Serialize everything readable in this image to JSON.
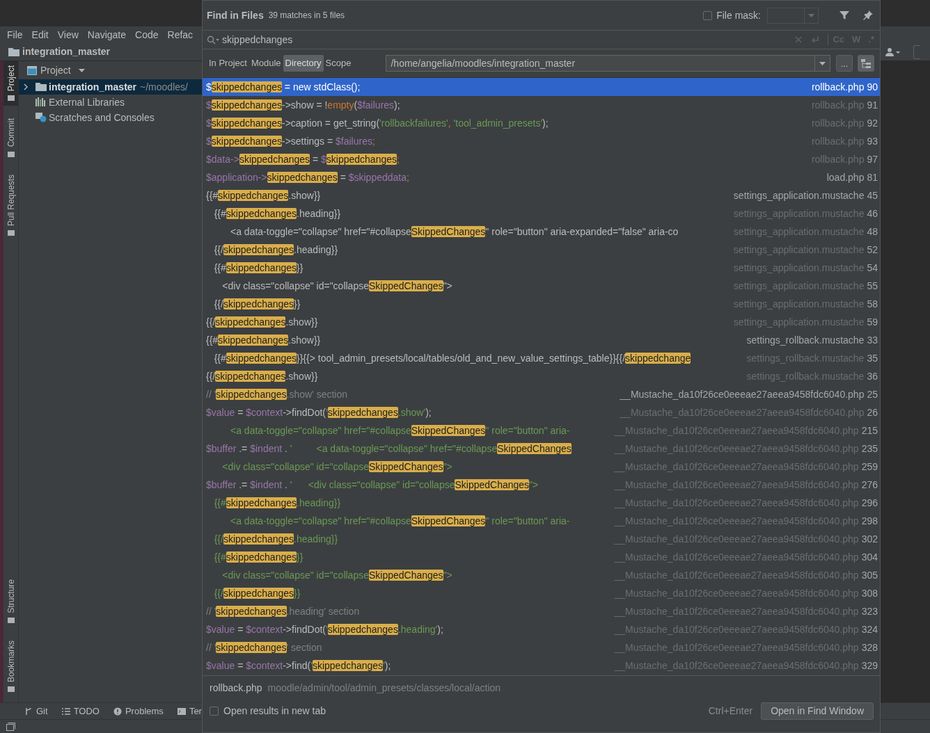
{
  "ide": {
    "menu": [
      "File",
      "Edit",
      "View",
      "Navigate",
      "Code",
      "Refac"
    ],
    "project_title": "integration_master",
    "side_tabs_top": [
      {
        "label": "Project",
        "selected": true
      },
      {
        "label": "Commit",
        "selected": false
      },
      {
        "label": "Pull Requests",
        "selected": false
      }
    ],
    "side_tabs_bottom": [
      {
        "label": "Structure",
        "selected": false
      },
      {
        "label": "Bookmarks",
        "selected": false
      }
    ],
    "panel_title": "Project",
    "tree": [
      {
        "label": "integration_master",
        "hint": "~/moodles/",
        "kind": "folder",
        "selected": true,
        "expanded": false
      },
      {
        "label": "External Libraries",
        "kind": "libraries",
        "selected": false
      },
      {
        "label": "Scratches and Consoles",
        "kind": "scratches",
        "selected": false
      }
    ],
    "bottom_tabs": [
      {
        "label": "Git",
        "kind": "git"
      },
      {
        "label": "TODO",
        "kind": "todo"
      },
      {
        "label": "Problems",
        "kind": "problems"
      },
      {
        "label": "Ter",
        "kind": "terminal"
      }
    ]
  },
  "dialog": {
    "title": "Find in Files",
    "summary": "39 matches in 5 files",
    "file_mask": {
      "label": "File mask:",
      "checked": false
    },
    "search": {
      "value": "skippedchanges"
    },
    "search_options": [
      "Cc",
      "W",
      ".*"
    ],
    "scopes": [
      {
        "label": "In Project",
        "selected": false
      },
      {
        "label": "Module",
        "selected": false
      },
      {
        "label": "Directory",
        "selected": true
      },
      {
        "label": "Scope",
        "selected": false
      }
    ],
    "directory": "/home/angelia/moodles/integration_master",
    "browse_button": "...",
    "results": [
      {
        "selected": true,
        "file": "rollback.php",
        "line": "90",
        "dim": false,
        "code": [
          {
            "kind": "var",
            "text": "$"
          },
          {
            "kind": "hit",
            "text": "skippedchanges"
          },
          {
            "kind": "plain",
            "text": " = new stdClass();"
          }
        ]
      },
      {
        "selected": false,
        "file": "rollback.php",
        "line": "91",
        "dim": true,
        "code": [
          {
            "kind": "var",
            "text": "$"
          },
          {
            "kind": "hit",
            "text": "skippedchanges"
          },
          {
            "kind": "plain",
            "text": "->show = !"
          },
          {
            "kind": "key",
            "text": "empty"
          },
          {
            "kind": "plain",
            "text": "("
          },
          {
            "kind": "var",
            "text": "$failures"
          },
          {
            "kind": "plain",
            "text": ");"
          }
        ]
      },
      {
        "selected": false,
        "file": "rollback.php",
        "line": "92",
        "dim": true,
        "code": [
          {
            "kind": "var",
            "text": "$"
          },
          {
            "kind": "hit",
            "text": "skippedchanges"
          },
          {
            "kind": "plain",
            "text": "->caption = get_string("
          },
          {
            "kind": "str",
            "text": "'rollbackfailures'"
          },
          {
            "kind": "key",
            "text": ", "
          },
          {
            "kind": "str",
            "text": "'tool_admin_presets'"
          },
          {
            "kind": "plain",
            "text": ");"
          }
        ]
      },
      {
        "selected": false,
        "file": "rollback.php",
        "line": "93",
        "dim": true,
        "code": [
          {
            "kind": "var",
            "text": "$"
          },
          {
            "kind": "hit",
            "text": "skippedchanges"
          },
          {
            "kind": "plain",
            "text": "->settings = "
          },
          {
            "kind": "var",
            "text": "$failures"
          },
          {
            "kind": "key",
            "text": ";"
          }
        ]
      },
      {
        "selected": false,
        "file": "rollback.php",
        "line": "97",
        "dim": true,
        "code": [
          {
            "kind": "var",
            "text": "$data->"
          },
          {
            "kind": "hit",
            "text": "skippedchanges"
          },
          {
            "kind": "plain",
            "text": " = "
          },
          {
            "kind": "var",
            "text": "$"
          },
          {
            "kind": "hit",
            "text": "skippedchanges"
          },
          {
            "kind": "key",
            "text": ";"
          }
        ]
      },
      {
        "selected": false,
        "file": "load.php",
        "line": "81",
        "dim": false,
        "code": [
          {
            "kind": "var",
            "text": "$application->"
          },
          {
            "kind": "hit",
            "text": "skippedchanges"
          },
          {
            "kind": "plain",
            "text": " = "
          },
          {
            "kind": "var",
            "text": "$skippeddata"
          },
          {
            "kind": "key",
            "text": ";"
          }
        ]
      },
      {
        "selected": false,
        "file": "settings_application.mustache",
        "line": "45",
        "dim": false,
        "code": [
          {
            "kind": "plain",
            "text": "{{#"
          },
          {
            "kind": "hit",
            "text": "skippedchanges"
          },
          {
            "kind": "plain",
            "text": ".show}}"
          }
        ]
      },
      {
        "selected": false,
        "file": "settings_application.mustache",
        "line": "46",
        "dim": true,
        "code": [
          {
            "kind": "plain",
            "text": "   {{#"
          },
          {
            "kind": "hit",
            "text": "skippedchanges"
          },
          {
            "kind": "plain",
            "text": ".heading}}"
          }
        ]
      },
      {
        "selected": false,
        "file": "settings_application.mustache",
        "line": "48",
        "dim": true,
        "code": [
          {
            "kind": "plain",
            "text": "         <a data-toggle=\"collapse\" href=\"#collapse"
          },
          {
            "kind": "hit",
            "text": "SkippedChanges"
          },
          {
            "kind": "plain",
            "text": "\" role=\"button\" aria-expanded=\"false\" aria-co"
          }
        ]
      },
      {
        "selected": false,
        "file": "settings_application.mustache",
        "line": "52",
        "dim": true,
        "code": [
          {
            "kind": "plain",
            "text": "   {{/"
          },
          {
            "kind": "hit",
            "text": "skippedchanges"
          },
          {
            "kind": "plain",
            "text": ".heading}}"
          }
        ]
      },
      {
        "selected": false,
        "file": "settings_application.mustache",
        "line": "54",
        "dim": true,
        "code": [
          {
            "kind": "plain",
            "text": "   {{#"
          },
          {
            "kind": "hit",
            "text": "skippedchanges"
          },
          {
            "kind": "plain",
            "text": "}}"
          }
        ]
      },
      {
        "selected": false,
        "file": "settings_application.mustache",
        "line": "55",
        "dim": true,
        "code": [
          {
            "kind": "plain",
            "text": "      <div class=\"collapse\" id=\"collapse"
          },
          {
            "kind": "hit",
            "text": "SkippedChanges"
          },
          {
            "kind": "plain",
            "text": "\">"
          }
        ]
      },
      {
        "selected": false,
        "file": "settings_application.mustache",
        "line": "58",
        "dim": true,
        "code": [
          {
            "kind": "plain",
            "text": "   {{/"
          },
          {
            "kind": "hit",
            "text": "skippedchanges"
          },
          {
            "kind": "plain",
            "text": "}}"
          }
        ]
      },
      {
        "selected": false,
        "file": "settings_application.mustache",
        "line": "59",
        "dim": true,
        "code": [
          {
            "kind": "plain",
            "text": "{{/"
          },
          {
            "kind": "hit",
            "text": "skippedchanges"
          },
          {
            "kind": "plain",
            "text": ".show}}"
          }
        ]
      },
      {
        "selected": false,
        "file": "settings_rollback.mustache",
        "line": "33",
        "dim": false,
        "code": [
          {
            "kind": "plain",
            "text": "{{#"
          },
          {
            "kind": "hit",
            "text": "skippedchanges"
          },
          {
            "kind": "plain",
            "text": ".show}}"
          }
        ]
      },
      {
        "selected": false,
        "file": "settings_rollback.mustache",
        "line": "35",
        "dim": true,
        "code": [
          {
            "kind": "plain",
            "text": "   {{#"
          },
          {
            "kind": "hit",
            "text": "skippedchanges"
          },
          {
            "kind": "plain",
            "text": "}}{{> tool_admin_presets/local/tables/old_and_new_value_settings_table}}{{/"
          },
          {
            "kind": "hit",
            "text": "skippedchange"
          }
        ]
      },
      {
        "selected": false,
        "file": "settings_rollback.mustache",
        "line": "36",
        "dim": true,
        "code": [
          {
            "kind": "plain",
            "text": "{{/"
          },
          {
            "kind": "hit",
            "text": "skippedchanges"
          },
          {
            "kind": "plain",
            "text": ".show}}"
          }
        ]
      },
      {
        "selected": false,
        "file": "__Mustache_da10f26ce0eeeae27aeea9458fdc6040.php",
        "line": "25",
        "dim": false,
        "code": [
          {
            "kind": "comment",
            "text": "// '"
          },
          {
            "kind": "hit",
            "text": "skippedchanges"
          },
          {
            "kind": "comment",
            "text": ".show' section"
          }
        ]
      },
      {
        "selected": false,
        "file": "__Mustache_da10f26ce0eeeae27aeea9458fdc6040.php",
        "line": "26",
        "dim": true,
        "code": [
          {
            "kind": "var",
            "text": "$value"
          },
          {
            "kind": "plain",
            "text": " = "
          },
          {
            "kind": "var",
            "text": "$context"
          },
          {
            "kind": "plain",
            "text": "->findDot("
          },
          {
            "kind": "str",
            "text": "'"
          },
          {
            "kind": "hit",
            "text": "skippedchanges"
          },
          {
            "kind": "str",
            "text": ".show'"
          },
          {
            "kind": "plain",
            "text": ");"
          }
        ]
      },
      {
        "selected": false,
        "file": "__Mustache_da10f26ce0eeeae27aeea9458fdc6040.php",
        "line": "215",
        "dim": true,
        "code": [
          {
            "kind": "str",
            "text": "         <a data-toggle=\"collapse\" href=\"#collapse"
          },
          {
            "kind": "hit",
            "text": "SkippedChanges"
          },
          {
            "kind": "str",
            "text": "\" role=\"button\" aria-"
          }
        ]
      },
      {
        "selected": false,
        "file": "__Mustache_da10f26ce0eeeae27aeea9458fdc6040.php",
        "line": "235",
        "dim": true,
        "code": [
          {
            "kind": "var",
            "text": "$buffer"
          },
          {
            "kind": "plain",
            "text": " .= "
          },
          {
            "kind": "var",
            "text": "$indent"
          },
          {
            "kind": "plain",
            "text": " . "
          },
          {
            "kind": "str",
            "text": "'         <a data-toggle=\"collapse\" href=\"#collapse"
          },
          {
            "kind": "hit",
            "text": "SkippedChanges"
          }
        ]
      },
      {
        "selected": false,
        "file": "__Mustache_da10f26ce0eeeae27aeea9458fdc6040.php",
        "line": "259",
        "dim": true,
        "code": [
          {
            "kind": "str",
            "text": "      <div class=\"collapse\" id=\"collapse"
          },
          {
            "kind": "hit",
            "text": "SkippedChanges"
          },
          {
            "kind": "str",
            "text": "\">"
          }
        ]
      },
      {
        "selected": false,
        "file": "__Mustache_da10f26ce0eeeae27aeea9458fdc6040.php",
        "line": "276",
        "dim": true,
        "code": [
          {
            "kind": "var",
            "text": "$buffer"
          },
          {
            "kind": "plain",
            "text": " .= "
          },
          {
            "kind": "var",
            "text": "$indent"
          },
          {
            "kind": "plain",
            "text": " . "
          },
          {
            "kind": "str",
            "text": "'      <div class=\"collapse\" id=\"collapse"
          },
          {
            "kind": "hit",
            "text": "SkippedChanges"
          },
          {
            "kind": "str",
            "text": "\">"
          }
        ]
      },
      {
        "selected": false,
        "file": "__Mustache_da10f26ce0eeeae27aeea9458fdc6040.php",
        "line": "296",
        "dim": true,
        "code": [
          {
            "kind": "str",
            "text": "   {{#"
          },
          {
            "kind": "hit",
            "text": "skippedchanges"
          },
          {
            "kind": "str",
            "text": ".heading}}"
          }
        ]
      },
      {
        "selected": false,
        "file": "__Mustache_da10f26ce0eeeae27aeea9458fdc6040.php",
        "line": "298",
        "dim": true,
        "code": [
          {
            "kind": "str",
            "text": "         <a data-toggle=\"collapse\" href=\"#collapse"
          },
          {
            "kind": "hit",
            "text": "SkippedChanges"
          },
          {
            "kind": "str",
            "text": "\" role=\"button\" aria-"
          }
        ]
      },
      {
        "selected": false,
        "file": "__Mustache_da10f26ce0eeeae27aeea9458fdc6040.php",
        "line": "302",
        "dim": true,
        "code": [
          {
            "kind": "str",
            "text": "   {{/"
          },
          {
            "kind": "hit",
            "text": "skippedchanges"
          },
          {
            "kind": "str",
            "text": ".heading}}"
          }
        ]
      },
      {
        "selected": false,
        "file": "__Mustache_da10f26ce0eeeae27aeea9458fdc6040.php",
        "line": "304",
        "dim": true,
        "code": [
          {
            "kind": "str",
            "text": "   {{#"
          },
          {
            "kind": "hit",
            "text": "skippedchanges"
          },
          {
            "kind": "str",
            "text": "}}"
          }
        ]
      },
      {
        "selected": false,
        "file": "__Mustache_da10f26ce0eeeae27aeea9458fdc6040.php",
        "line": "305",
        "dim": true,
        "code": [
          {
            "kind": "str",
            "text": "      <div class=\"collapse\" id=\"collapse"
          },
          {
            "kind": "hit",
            "text": "SkippedChanges"
          },
          {
            "kind": "str",
            "text": "\">"
          }
        ]
      },
      {
        "selected": false,
        "file": "__Mustache_da10f26ce0eeeae27aeea9458fdc6040.php",
        "line": "308",
        "dim": true,
        "code": [
          {
            "kind": "str",
            "text": "   {{/"
          },
          {
            "kind": "hit",
            "text": "skippedchanges"
          },
          {
            "kind": "str",
            "text": "}}"
          }
        ]
      },
      {
        "selected": false,
        "file": "__Mustache_da10f26ce0eeeae27aeea9458fdc6040.php",
        "line": "323",
        "dim": true,
        "code": [
          {
            "kind": "comment",
            "text": "// '"
          },
          {
            "kind": "hit",
            "text": "skippedchanges"
          },
          {
            "kind": "comment",
            "text": ".heading' section"
          }
        ]
      },
      {
        "selected": false,
        "file": "__Mustache_da10f26ce0eeeae27aeea9458fdc6040.php",
        "line": "324",
        "dim": true,
        "code": [
          {
            "kind": "var",
            "text": "$value"
          },
          {
            "kind": "plain",
            "text": " = "
          },
          {
            "kind": "var",
            "text": "$context"
          },
          {
            "kind": "plain",
            "text": "->findDot("
          },
          {
            "kind": "str",
            "text": "'"
          },
          {
            "kind": "hit",
            "text": "skippedchanges"
          },
          {
            "kind": "str",
            "text": ".heading'"
          },
          {
            "kind": "plain",
            "text": ");"
          }
        ]
      },
      {
        "selected": false,
        "file": "__Mustache_da10f26ce0eeeae27aeea9458fdc6040.php",
        "line": "328",
        "dim": true,
        "code": [
          {
            "kind": "comment",
            "text": "// '"
          },
          {
            "kind": "hit",
            "text": "skippedchanges"
          },
          {
            "kind": "comment",
            "text": "' section"
          }
        ]
      },
      {
        "selected": false,
        "file": "__Mustache_da10f26ce0eeeae27aeea9458fdc6040.php",
        "line": "329",
        "dim": true,
        "code": [
          {
            "kind": "var",
            "text": "$value"
          },
          {
            "kind": "plain",
            "text": " = "
          },
          {
            "kind": "var",
            "text": "$context"
          },
          {
            "kind": "plain",
            "text": "->find("
          },
          {
            "kind": "str",
            "text": "'"
          },
          {
            "kind": "hit",
            "text": "skippedchanges"
          },
          {
            "kind": "str",
            "text": "'"
          },
          {
            "kind": "plain",
            "text": ");"
          }
        ]
      }
    ],
    "preview": {
      "file": "rollback.php",
      "path": "moodle/admin/tool/admin_presets/classes/local/action"
    },
    "new_tab": {
      "label": "Open results in new tab",
      "checked": false
    },
    "shortcut": "Ctrl+Enter",
    "open_button": "Open in Find Window"
  }
}
